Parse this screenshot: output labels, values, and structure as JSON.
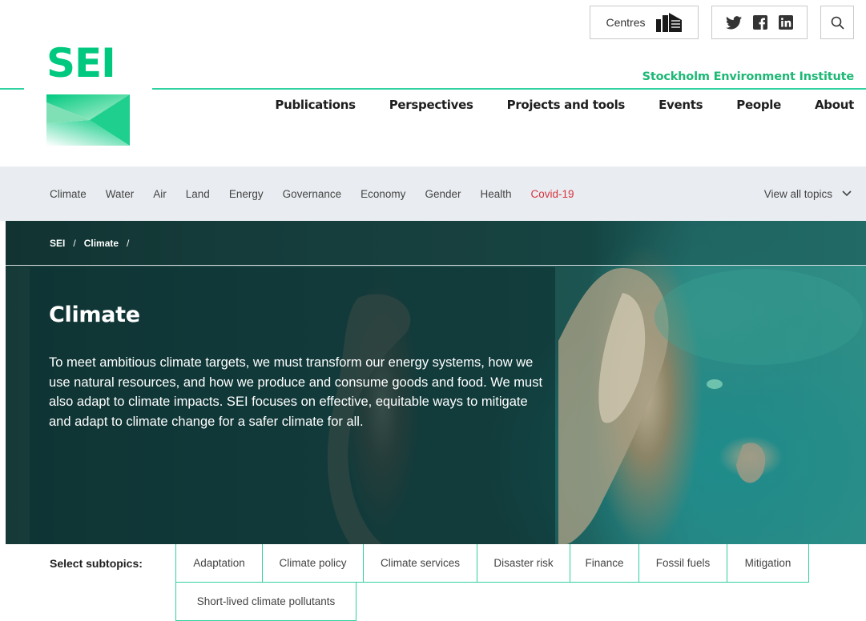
{
  "header": {
    "logo_text": "SEI",
    "centres_label": "Centres",
    "org_name": "Stockholm Environment Institute",
    "nav": [
      "Publications",
      "Perspectives",
      "Projects and tools",
      "Events",
      "People",
      "About"
    ],
    "icons": {
      "centres": "buildings-icon",
      "twitter": "twitter-icon",
      "facebook": "facebook-icon",
      "linkedin": "linkedin-icon",
      "search": "search-icon"
    }
  },
  "topics": {
    "items": [
      "Climate",
      "Water",
      "Air",
      "Land",
      "Energy",
      "Governance",
      "Economy",
      "Gender",
      "Health",
      "Covid-19"
    ],
    "view_all": "View all topics"
  },
  "breadcrumb": [
    "SEI",
    "Climate"
  ],
  "hero": {
    "title": "Climate",
    "body": "To meet ambitious climate targets, we must transform our energy systems, how we use natural resources, and how we produce and consume goods and food. We must also adapt to climate impacts. SEI focuses on effective, equitable ways to mitigate and adapt to climate change for a safer climate for all."
  },
  "subtopics": {
    "label": "Select subtopics:",
    "items": [
      "Adaptation",
      "Climate policy",
      "Climate services",
      "Disaster risk",
      "Finance",
      "Fossil fuels",
      "Mitigation",
      "Short-lived climate pollutants"
    ]
  },
  "colors": {
    "brand_green": "#00c97f",
    "accent_line": "#2fd1a0",
    "org_name": "#1db876",
    "covid_red": "#d6323c",
    "topics_bg": "#e9edf1"
  }
}
